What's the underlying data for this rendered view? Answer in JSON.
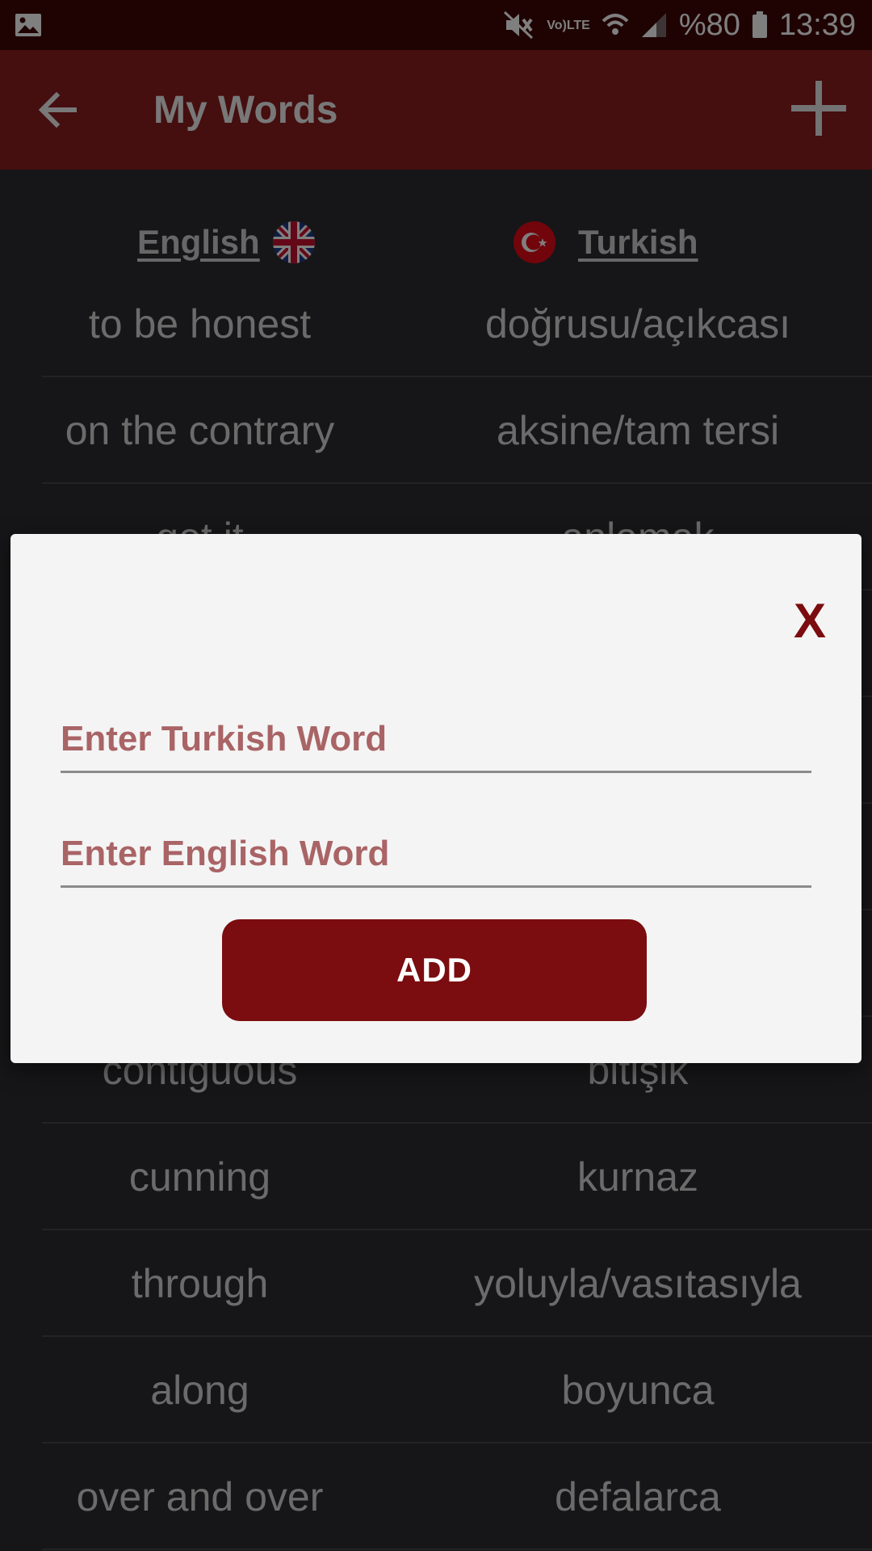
{
  "status_bar": {
    "battery": "%80",
    "time": "13:39",
    "network": "LTE"
  },
  "app_bar": {
    "title": "My Words"
  },
  "languages": {
    "source": "English",
    "target": "Turkish"
  },
  "words": [
    {
      "en": "to be honest",
      "tr": "doğrusu/açıkcası"
    },
    {
      "en": "on the contrary",
      "tr": "aksine/tam tersi"
    },
    {
      "en": "get it",
      "tr": "anlamak"
    },
    {
      "en": "",
      "tr": ""
    },
    {
      "en": "",
      "tr": ""
    },
    {
      "en": "",
      "tr": ""
    },
    {
      "en": "",
      "tr": ""
    },
    {
      "en": "contiguous",
      "tr": "bitişik"
    },
    {
      "en": "cunning",
      "tr": "kurnaz"
    },
    {
      "en": "through",
      "tr": "yoluyla/vasıtasıyla"
    },
    {
      "en": "along",
      "tr": "boyunca"
    },
    {
      "en": "over and over",
      "tr": "defalarca"
    }
  ],
  "dialog": {
    "close_label": "X",
    "turkish_placeholder": "Enter Turkish Word",
    "english_placeholder": "Enter English Word",
    "turkish_value": "",
    "english_value": "",
    "add_label": "ADD"
  },
  "colors": {
    "accent": "#7b0c0f",
    "app_bar": "#8a1d1f",
    "status_bar": "#3f0607",
    "placeholder": "#a96466"
  }
}
